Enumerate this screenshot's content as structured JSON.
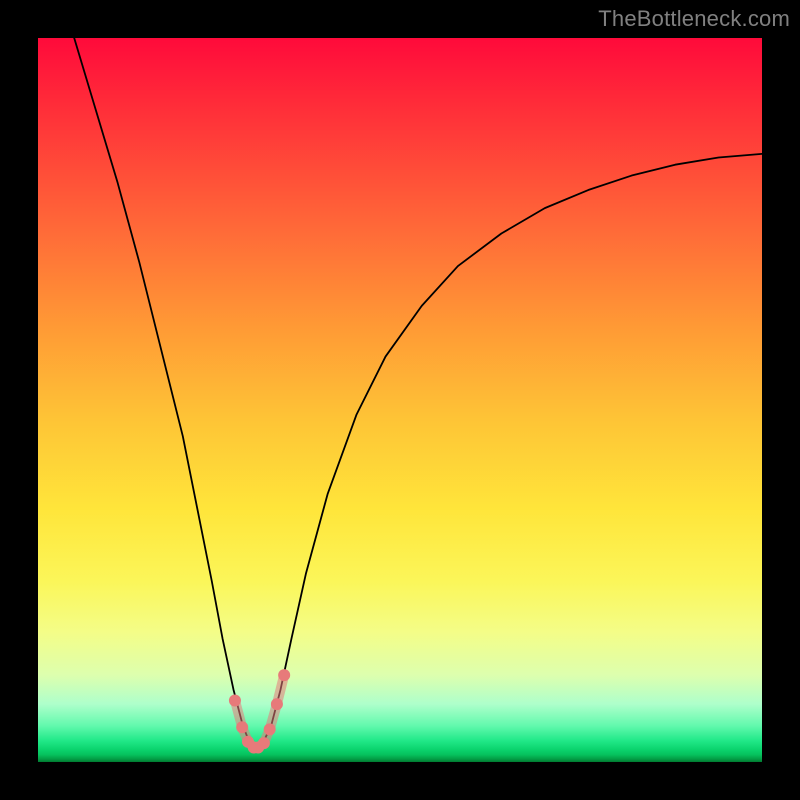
{
  "watermark": "TheBottleneck.com",
  "chart_data": {
    "type": "line",
    "title": "",
    "xlabel": "",
    "ylabel": "",
    "xlim": [
      0,
      100
    ],
    "ylim": [
      0,
      100
    ],
    "grid": false,
    "series": [
      {
        "name": "bottleneck-curve",
        "stroke": "#000000",
        "stroke_width": 1.8,
        "x": [
          5,
          8,
          11,
          14,
          17,
          20,
          22,
          24,
          25.5,
          27,
          28.3,
          29.3,
          30.2,
          31,
          32.2,
          33.5,
          35,
          37,
          40,
          44,
          48,
          53,
          58,
          64,
          70,
          76,
          82,
          88,
          94,
          100
        ],
        "y": [
          100,
          90,
          80,
          69,
          57,
          45,
          35,
          25,
          17,
          10,
          5,
          2.5,
          1.8,
          2.5,
          5,
          10,
          17,
          26,
          37,
          48,
          56,
          63,
          68.5,
          73,
          76.5,
          79,
          81,
          82.5,
          83.5,
          84
        ],
        "note": "Percent bottleneck vs. configuration axis. Minimum (~2%) occurs near x≈30; curve rises steeply on both sides forming a V with an asymmetric right shoulder."
      },
      {
        "name": "optimal-range-markers",
        "type": "scatter",
        "stroke": "#e77a7a",
        "fill": "#e77a7a",
        "radius": 6,
        "x": [
          27.2,
          28.2,
          29.0,
          29.8,
          30.4,
          31.2,
          32.0,
          33.0,
          34.0
        ],
        "y": [
          8.5,
          4.8,
          2.8,
          2.0,
          2.0,
          2.6,
          4.5,
          8.0,
          12.0
        ],
        "note": "Dots marking the near-optimal (green) region at the valley bottom."
      }
    ]
  }
}
